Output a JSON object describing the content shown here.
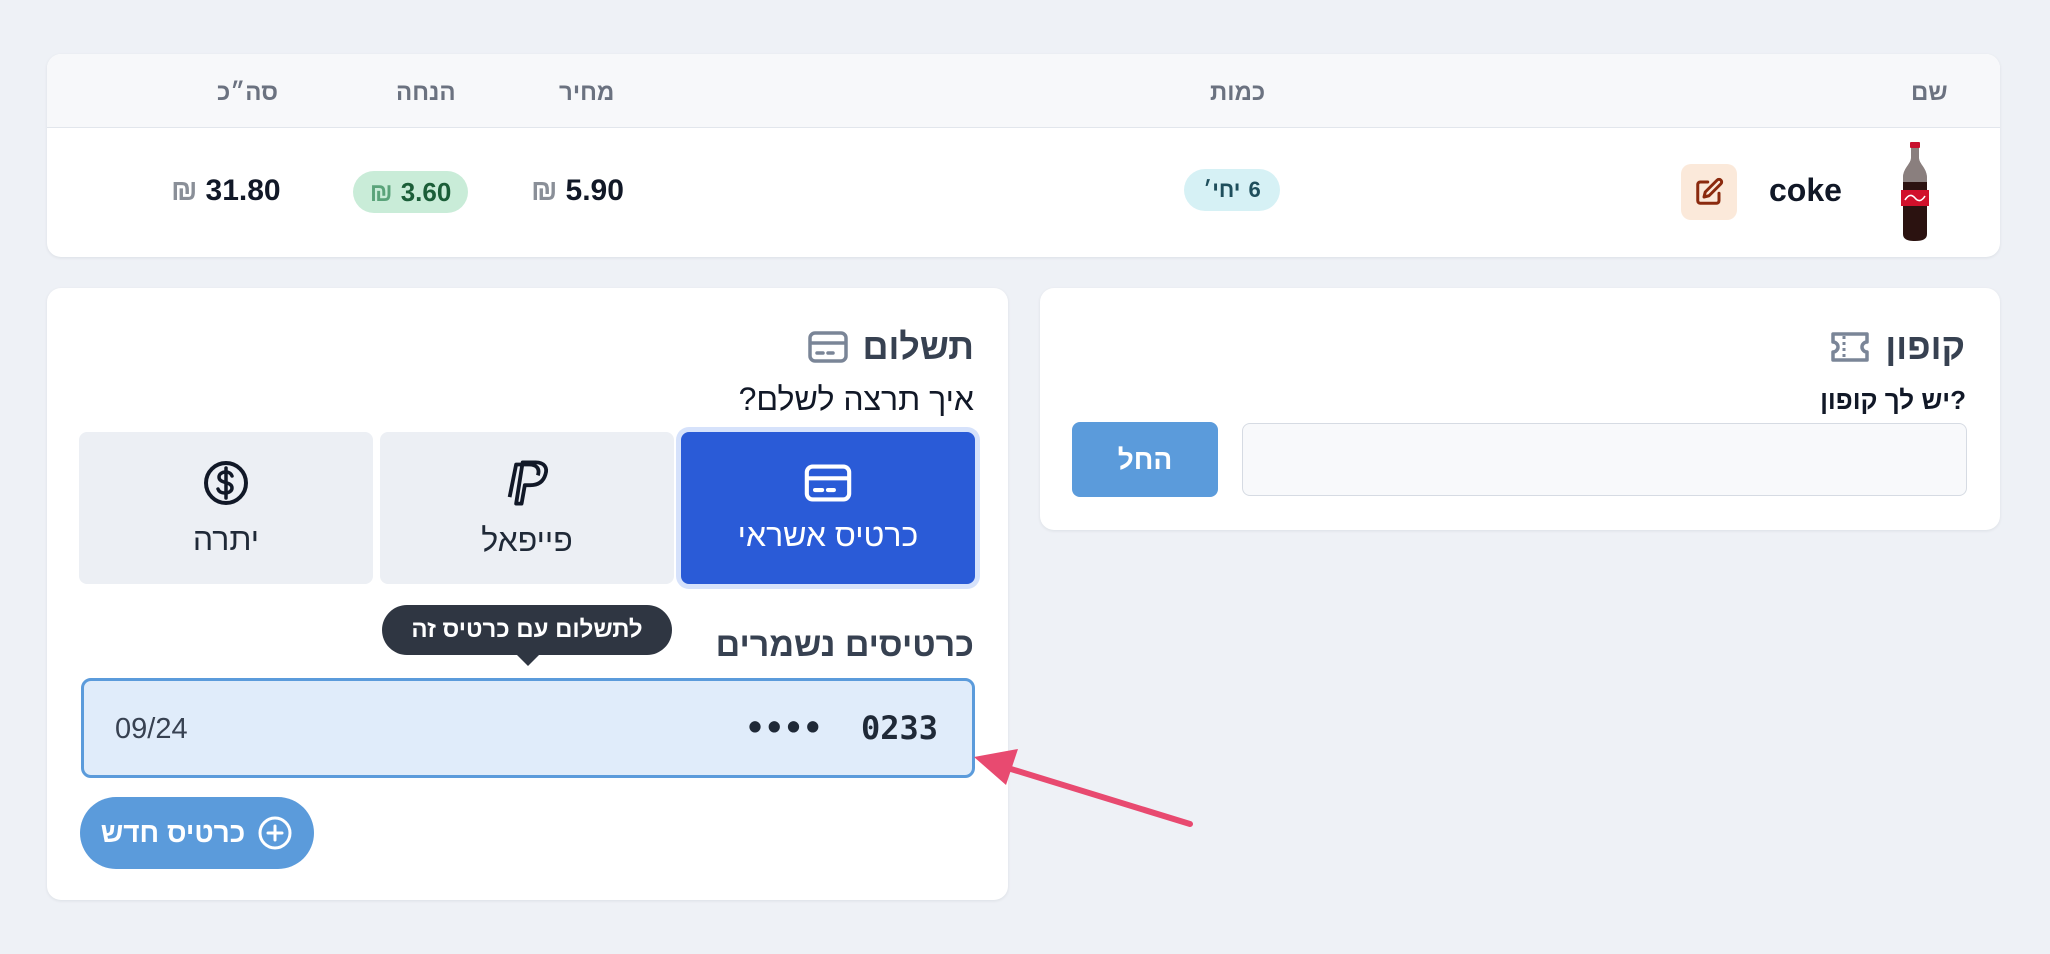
{
  "colors": {
    "page_background": "#eef1f6",
    "primary": "#2a5bd7",
    "accent_button": "#5b9bdb",
    "discount_pill": "#c9ecd8",
    "quantity_pill": "#d6f1f5",
    "arrow": "#e84a70"
  },
  "order_table": {
    "headers": {
      "name": "שם",
      "quantity": "כמות",
      "price": "מחיר",
      "discount": "הנחה",
      "total": "סה״כ"
    },
    "rows": [
      {
        "product_name": "coke",
        "image_icon": "coke-bottle-icon",
        "quantity": "6",
        "quantity_unit": "יחי׳",
        "currency": "₪",
        "price": "5.90",
        "discount": "3.60",
        "total": "31.80"
      }
    ]
  },
  "coupon": {
    "title": "קופון",
    "icon": "ticket-icon",
    "field_label": "יש לך קופון?",
    "input_value": "",
    "input_placeholder": "",
    "apply_label": "החל"
  },
  "payment": {
    "title": "תשלום",
    "icon": "credit-card-icon",
    "question": "איך תרצה לשלם?",
    "methods": [
      {
        "label": "כרטיס אשראי",
        "icon": "credit-card-icon",
        "selected": true
      },
      {
        "label": "פייפאל",
        "icon": "paypal-icon",
        "selected": false
      },
      {
        "label": "יתרה",
        "icon": "dollar-circle-icon",
        "selected": false
      }
    ],
    "saved_cards_title": "כרטיסים נשמרים",
    "saved_card": {
      "masked_dots": "••••",
      "last4": "0233",
      "expiry": "09/24"
    },
    "tooltip": "לתשלום עם כרטיס זה",
    "new_card_label": "כרטיס חדש"
  }
}
